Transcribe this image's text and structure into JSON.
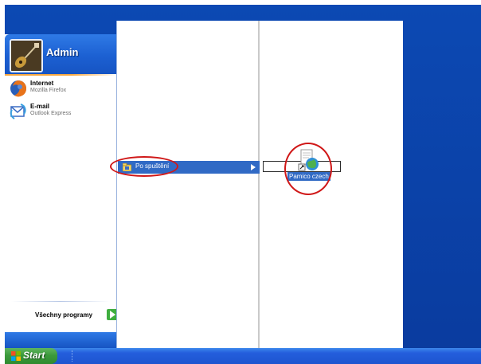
{
  "start_menu": {
    "user": {
      "name": "Admin",
      "avatar_icon": "guitar-icon"
    },
    "pinned": [
      {
        "title": "Internet",
        "subtitle": "Mozilla Firefox",
        "icon": "firefox-icon"
      },
      {
        "title": "E-mail",
        "subtitle": "Outlook Express",
        "icon": "outlook-express-icon"
      }
    ],
    "all_programs": {
      "label": "Všechny programy",
      "icon": "green-arrow-icon"
    }
  },
  "programs_menu": {
    "selected_item": {
      "label": "Po spuštění",
      "icon": "program-folder-icon"
    }
  },
  "startup_menu": {
    "items": [
      {
        "label": "Pamico czech",
        "icon": "shortcut-globe-icon"
      }
    ]
  },
  "taskbar": {
    "start_label": "Start"
  },
  "colors": {
    "desktop_blue": "#0a3fa6",
    "selection_blue": "#316ac5",
    "highlight_red": "#d01818",
    "start_green": "#3c9a3c"
  }
}
